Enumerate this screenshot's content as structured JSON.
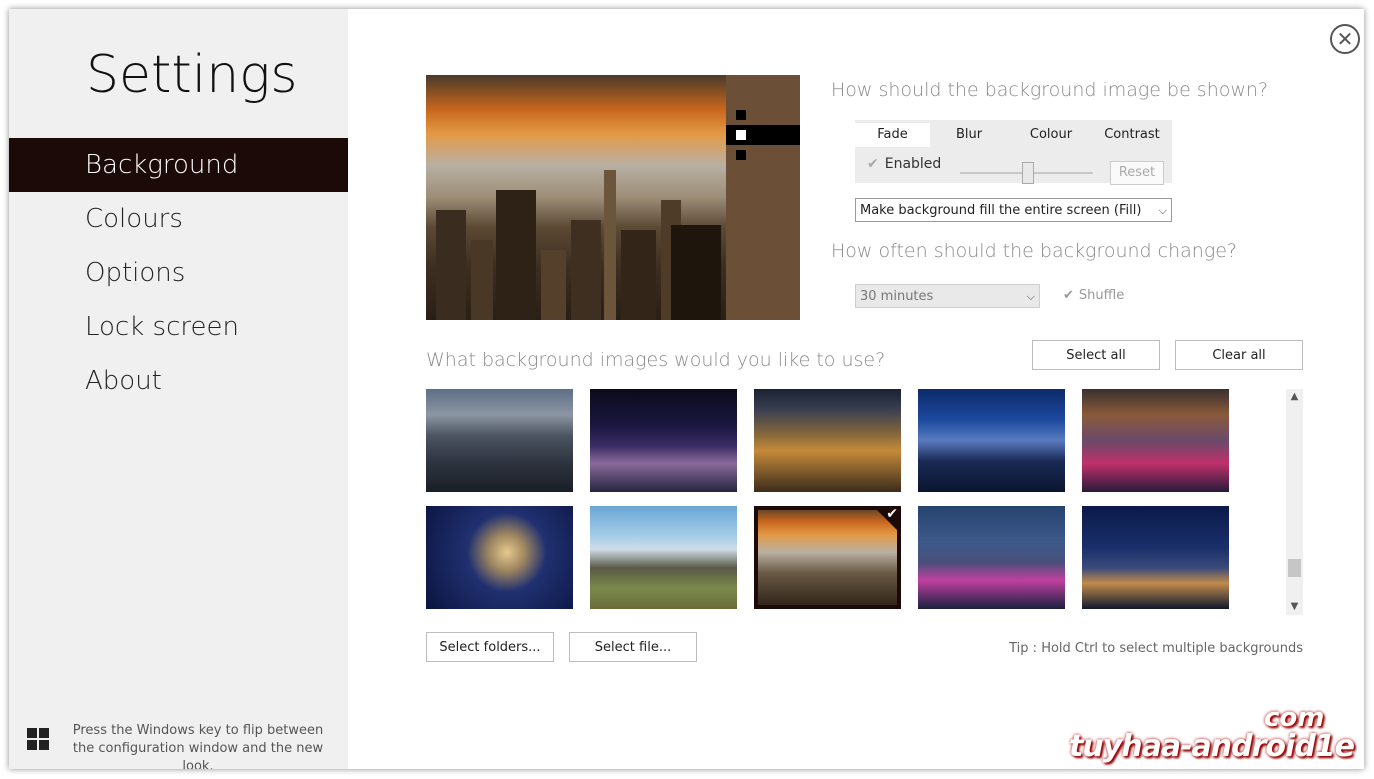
{
  "window": {
    "close_symbol": "✕"
  },
  "sidebar": {
    "title": "Settings",
    "items": [
      {
        "label": "Background",
        "active": true
      },
      {
        "label": "Colours"
      },
      {
        "label": "Options"
      },
      {
        "label": "Lock screen"
      },
      {
        "label": "About"
      }
    ],
    "footer_text": "Press the Windows key to flip between the configuration window and the new look."
  },
  "display": {
    "question": "How should the background image be shown?",
    "tabs": [
      "Fade",
      "Blur",
      "Colour",
      "Contrast"
    ],
    "active_tab": "Fade",
    "enabled_label": "Enabled",
    "reset_label": "Reset",
    "slider_value_fraction": 0.5,
    "fit_select": "Make background fill the entire screen (Fill)"
  },
  "change": {
    "question": "How often should the background change?",
    "interval_select": "30 minutes",
    "shuffle_label": "Shuffle"
  },
  "images": {
    "question": "What background images would you like to use?",
    "select_all_label": "Select all",
    "clear_all_label": "Clear all",
    "select_folders_label": "Select folders...",
    "select_file_label": "Select file...",
    "tip": "Tip : Hold Ctrl to select multiple backgrounds",
    "thumbnails": [
      {
        "icon": "city-skyline-dusk-thumb",
        "selected": false
      },
      {
        "icon": "city-night-neon-thumb",
        "selected": false
      },
      {
        "icon": "city-lights-aerial-thumb",
        "selected": false
      },
      {
        "icon": "singapore-skyline-thumb",
        "selected": false
      },
      {
        "icon": "fireworks-harbour-thumb",
        "selected": false
      },
      {
        "icon": "fireworks-burst-thumb",
        "selected": false
      },
      {
        "icon": "machu-picchu-thumb",
        "selected": false
      },
      {
        "icon": "new-york-sunset-thumb",
        "selected": true
      },
      {
        "icon": "ferris-wheel-night-thumb",
        "selected": false
      },
      {
        "icon": "london-shard-night-thumb",
        "selected": false
      }
    ]
  },
  "watermark": {
    "text": "tuyhaa-android1e",
    "suffix": "com"
  },
  "colors": {
    "accent": "#1b0a07",
    "sidebar_bg": "#f0f0f0",
    "preview_side": "#6b4f36"
  }
}
